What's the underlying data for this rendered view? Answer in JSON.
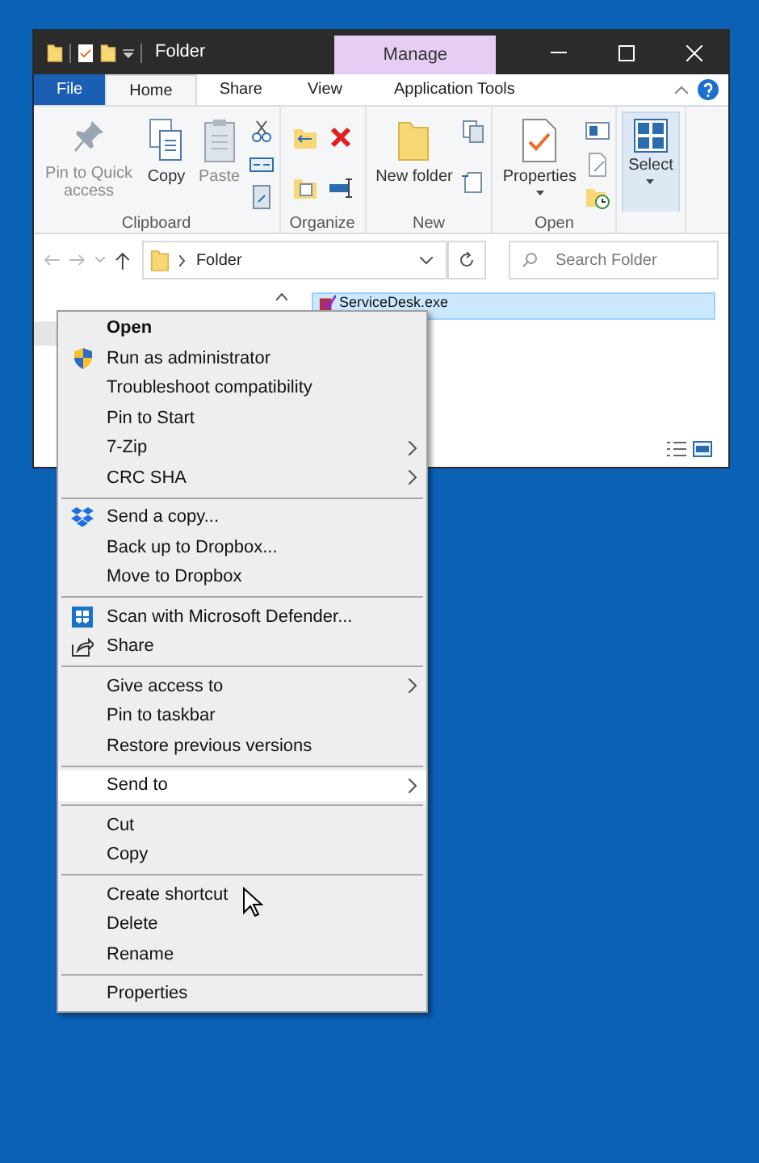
{
  "window": {
    "title": "Folder",
    "contextual_tab": "Manage"
  },
  "ribbon_tabs": [
    {
      "label": "File",
      "kind": "file",
      "selected": false
    },
    {
      "label": "Home",
      "kind": "tab",
      "selected": true
    },
    {
      "label": "Share",
      "kind": "tab",
      "selected": false
    },
    {
      "label": "View",
      "kind": "tab",
      "selected": false
    },
    {
      "label": "Application Tools",
      "kind": "contextual",
      "selected": false
    }
  ],
  "ribbon_groups": [
    {
      "name": "Clipboard",
      "buttons": [
        {
          "label": "Pin to Quick access",
          "kind": "pin",
          "disabled": true,
          "highlighted": false
        },
        {
          "label": "Copy",
          "kind": "copy",
          "disabled": false,
          "highlighted": false
        },
        {
          "label": "Paste",
          "kind": "paste",
          "disabled": true,
          "highlighted": false
        }
      ]
    },
    {
      "name": "Organize"
    },
    {
      "name": "New",
      "buttons": [
        {
          "label": "New folder",
          "kind": "folder",
          "disabled": false,
          "highlighted": false
        }
      ]
    },
    {
      "name": "Open",
      "buttons": [
        {
          "label": "Properties",
          "kind": "properties",
          "disabled": false,
          "highlighted": false
        }
      ]
    },
    {
      "buttons": [
        {
          "label": "Select",
          "kind": "select",
          "disabled": false,
          "highlighted": true
        }
      ]
    }
  ],
  "address": {
    "path": "Folder"
  },
  "search": {
    "placeholder": "Search Folder"
  },
  "file": {
    "name": "ServiceDesk.exe",
    "selected": true
  },
  "context_menu": [
    [
      {
        "label": "Open",
        "bold": true,
        "submenu": false,
        "selected": false
      },
      {
        "label": "Run as administrator",
        "bold": false,
        "submenu": false,
        "selected": false
      },
      {
        "label": "Troubleshoot compatibility",
        "bold": false,
        "submenu": false,
        "selected": false
      },
      {
        "label": "Pin to Start",
        "bold": false,
        "submenu": false,
        "selected": false
      },
      {
        "label": "7-Zip",
        "bold": false,
        "submenu": true,
        "selected": false
      },
      {
        "label": "CRC SHA",
        "bold": false,
        "submenu": true,
        "selected": false
      }
    ],
    [
      {
        "label": "Send a copy...",
        "bold": false,
        "submenu": false,
        "selected": false
      },
      {
        "label": "Back up to Dropbox...",
        "bold": false,
        "submenu": false,
        "selected": false
      },
      {
        "label": "Move to Dropbox",
        "bold": false,
        "submenu": false,
        "selected": false
      }
    ],
    [
      {
        "label": "Scan with Microsoft Defender...",
        "bold": false,
        "submenu": false,
        "selected": false
      },
      {
        "label": "Share",
        "bold": false,
        "submenu": false,
        "selected": false
      }
    ],
    [
      {
        "label": "Give access to",
        "bold": false,
        "submenu": true,
        "selected": false
      },
      {
        "label": "Pin to taskbar",
        "bold": false,
        "submenu": false,
        "selected": false
      },
      {
        "label": "Restore previous versions",
        "bold": false,
        "submenu": false,
        "selected": false
      }
    ],
    [
      {
        "label": "Send to",
        "bold": false,
        "submenu": true,
        "selected": true
      }
    ],
    [
      {
        "label": "Cut",
        "bold": false,
        "submenu": false,
        "selected": false
      },
      {
        "label": "Copy",
        "bold": false,
        "submenu": false,
        "selected": false
      }
    ],
    [
      {
        "label": "Create shortcut",
        "bold": false,
        "submenu": false,
        "selected": false
      },
      {
        "label": "Delete",
        "bold": false,
        "submenu": false,
        "selected": false
      },
      {
        "label": "Rename",
        "bold": false,
        "submenu": false,
        "selected": false
      }
    ],
    [
      {
        "label": "Properties",
        "bold": false,
        "submenu": false,
        "selected": false
      }
    ]
  ]
}
